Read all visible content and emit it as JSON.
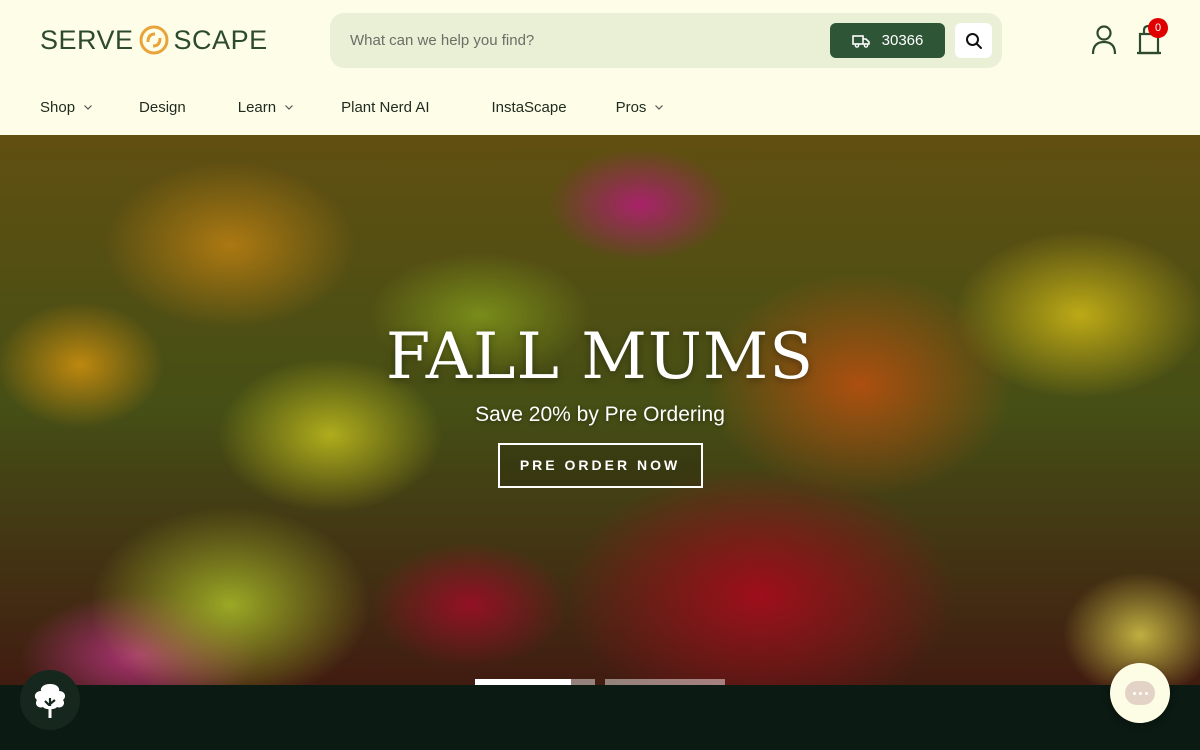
{
  "brand": {
    "logo_left": "SERVE",
    "logo_right": "SCAPE",
    "logo_color": "#2d4a2f",
    "accent": "#e8a33a"
  },
  "search": {
    "placeholder": "What can we help you find?",
    "zip_code": "30366",
    "zip_icon": "delivery-truck-icon",
    "button_icon": "search-icon"
  },
  "header_icons": {
    "account_icon": "user-icon",
    "cart_icon": "shopping-bag-icon",
    "cart_count": "0"
  },
  "nav": {
    "items": [
      {
        "label": "Shop",
        "has_dropdown": true
      },
      {
        "label": "Design",
        "has_dropdown": false
      },
      {
        "label": "Learn",
        "has_dropdown": true
      },
      {
        "label": "Plant Nerd AI",
        "has_dropdown": false
      },
      {
        "label": "InstaScape",
        "has_dropdown": false
      },
      {
        "label": "Pros",
        "has_dropdown": true
      }
    ]
  },
  "hero": {
    "title": "FALL MUMS",
    "subtitle": "Save 20% by Pre Ordering",
    "cta_label": "PRE ORDER NOW"
  },
  "carousel": {
    "slide_count": 2,
    "active_slide": 1,
    "active_progress": 0.8
  },
  "floating": {
    "left_icon": "tree-icon",
    "right_icon": "chat-bubble-icon"
  },
  "colors": {
    "header_bg": "#fefee8",
    "search_bg": "#eaf0d6",
    "zip_button": "#2e5535",
    "badge": "#e00000",
    "footer_band": "#0b1a13"
  }
}
